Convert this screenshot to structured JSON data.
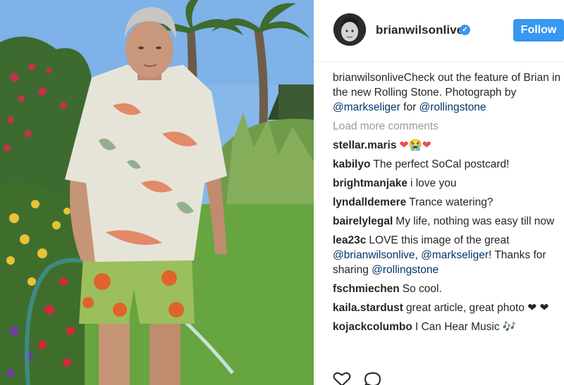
{
  "post": {
    "username": "brianwilsonlive",
    "follow_label": "Follow",
    "caption": {
      "user": "brianwilsonlive",
      "text_1": "Check out the feature of Brian in the new Rolling Stone. Photograph by ",
      "mention_1": "@markseliger",
      "text_2": " for ",
      "mention_2": "@rollingstone"
    },
    "load_more": "Load more comments"
  },
  "comments": [
    {
      "user": "stellar.maris",
      "text": "❤😭❤"
    },
    {
      "user": "kabilyo",
      "text": "The perfect SoCal postcard!"
    },
    {
      "user": "brightmanjake",
      "text": "i love you"
    },
    {
      "user": "lyndalldemere",
      "text": "Trance watering?"
    },
    {
      "user": "bairelylegal",
      "text": "My life, nothing was easy till now"
    },
    {
      "user": "lea23c",
      "text_1": "LOVE this image of the great ",
      "mention_1": "@brianwilsonlive",
      "text_2": ", ",
      "mention_2": "@markseliger",
      "text_3": "! Thanks for sharing ",
      "mention_3": "@rollingstone"
    },
    {
      "user": "fschmiechen",
      "text": "So cool."
    },
    {
      "user": "kaila.stardust",
      "text": "great article, great photo ❤ ❤"
    },
    {
      "user": "kojackcolumbo",
      "text": "I Can Hear Music 🎶"
    }
  ],
  "icons": {
    "verified": "verified-badge-icon",
    "like": "heart-icon",
    "comment": "comment-bubble-icon"
  },
  "colors": {
    "accent": "#3897f0",
    "text": "#262626",
    "muted": "#999999",
    "mention": "#003569"
  }
}
